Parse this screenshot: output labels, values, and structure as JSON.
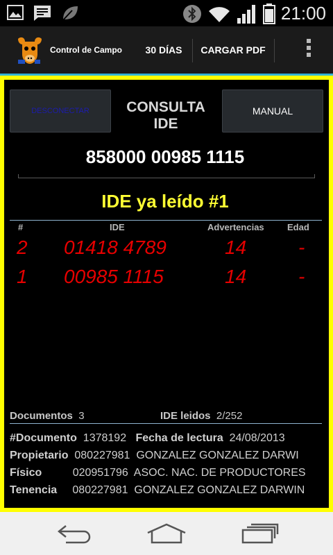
{
  "status_bar": {
    "time": "21:00",
    "left_icons": [
      "image-icon",
      "message-icon",
      "leaf-icon"
    ],
    "right_icons": [
      "bluetooth-icon",
      "wifi-icon",
      "signal-icon",
      "battery-icon"
    ]
  },
  "action_bar": {
    "app_title": "Control de Campo",
    "btn_30_days": "30 DÍAS",
    "btn_load_pdf": "CARGAR PDF",
    "overflow_icon": "overflow-menu-icon"
  },
  "panel": {
    "disconnect_label": "DESCONECTAR",
    "title_line1": "CONSULTA",
    "title_line2": "IDE",
    "manual_label": "MANUAL",
    "ide_value": "858000 00985 1115",
    "status_message": "IDE ya leído #1"
  },
  "table": {
    "headers": {
      "num": "#",
      "ide": "IDE",
      "warnings": "Advertencias",
      "age": "Edad"
    },
    "rows": [
      {
        "num": "2",
        "ide": "01418 4789",
        "warnings": "14",
        "age": "-"
      },
      {
        "num": "1",
        "ide": "00985 1115",
        "warnings": "14",
        "age": "-"
      }
    ]
  },
  "summary": {
    "docs_label": "Documentos",
    "docs_value": "3",
    "ide_read_label": "IDE leidos",
    "ide_read_value": "2/252"
  },
  "details": {
    "doc_label": "#Documento",
    "doc_value": "1378192",
    "date_label": "Fecha de lectura",
    "date_value": "24/08/2013",
    "owner_label": "Propietario",
    "owner_id": "080227981",
    "owner_name": "GONZALEZ GONZALEZ DARWI",
    "physical_label": "Físico",
    "physical_id": "020951796",
    "physical_name": "ASOC. NAC. DE PRODUCTORES",
    "tenure_label": "Tenencia",
    "tenure_id": "080227981",
    "tenure_name": "GONZALEZ GONZALEZ DARWIN"
  },
  "nav_bar": {
    "icons": [
      "back-icon",
      "home-icon",
      "recent-apps-icon"
    ]
  },
  "colors": {
    "frame": "#ffff00",
    "accent_line": "#32b5d6",
    "status_message": "#ffff33",
    "row_text": "#e60000"
  }
}
